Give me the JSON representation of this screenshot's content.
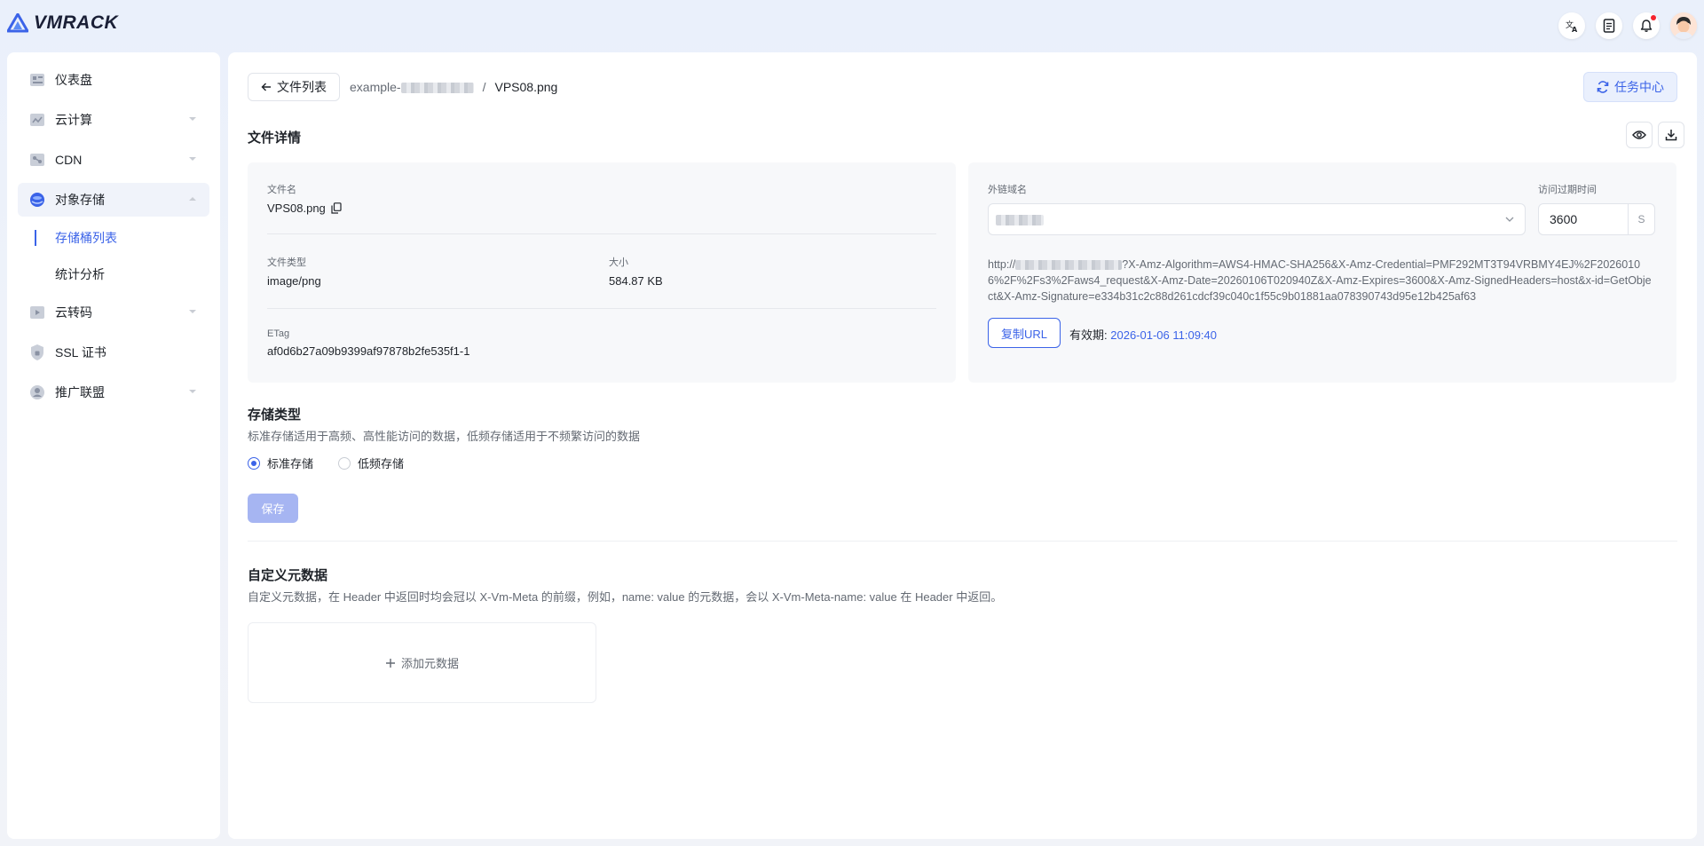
{
  "app": {
    "brand": "VMRACK"
  },
  "topbar": {
    "icons": [
      "translate-icon",
      "document-icon",
      "bell-icon",
      "avatar"
    ]
  },
  "sidebar": {
    "items": [
      {
        "label": "仪表盘",
        "icon": "dashboard-icon",
        "has_caret": false
      },
      {
        "label": "云计算",
        "icon": "cloud-compute-icon",
        "has_caret": true
      },
      {
        "label": "CDN",
        "icon": "cdn-icon",
        "has_caret": true
      },
      {
        "label": "对象存储",
        "icon": "object-storage-icon",
        "has_caret": true,
        "expanded": true
      },
      {
        "label": "云转码",
        "icon": "transcode-icon",
        "has_caret": true
      },
      {
        "label": "SSL 证书",
        "icon": "ssl-shield-icon",
        "has_caret": false
      },
      {
        "label": "推广联盟",
        "icon": "affiliate-icon",
        "has_caret": true
      }
    ],
    "subitems": [
      {
        "label": "存储桶列表",
        "active": true
      },
      {
        "label": "统计分析",
        "active": false
      }
    ]
  },
  "header": {
    "back_label": "文件列表",
    "breadcrumb_bucket": "example-",
    "breadcrumb_sep": "/",
    "breadcrumb_file": "VPS08.png",
    "task_center": "任务中心"
  },
  "file_details": {
    "title": "文件详情",
    "name_label": "文件名",
    "name_value": "VPS08.png",
    "type_label": "文件类型",
    "type_value": "image/png",
    "size_label": "大小",
    "size_value": "584.87 KB",
    "etag_label": "ETag",
    "etag_value": "af0d6b27a09b9399af97878b2fe535f1-1"
  },
  "link": {
    "domain_label": "外链域名",
    "expire_label": "访问过期时间",
    "expire_value": "3600",
    "expire_unit": "S",
    "url_prefix": "http://",
    "url_rest": "?X-Amz-Algorithm=AWS4-HMAC-SHA256&X-Amz-Credential=PMF292MT3T94VRBMY4EJ%2F20260106%2F%2Fs3%2Faws4_request&X-Amz-Date=20260106T020940Z&X-Amz-Expires=3600&X-Amz-SignedHeaders=host&x-id=GetObject&X-Amz-Signature=e334b31c2c88d261cdcf39c040c1f55c9b01881aa078390743d95e12b425af63",
    "copy_label": "复制URL",
    "valid_label": "有效期:",
    "valid_date": "2026-01-06 11:09:40"
  },
  "storage": {
    "title": "存储类型",
    "desc": "标准存储适用于高频、高性能访问的数据，低频存储适用于不频繁访问的数据",
    "options": [
      {
        "label": "标准存储",
        "checked": true
      },
      {
        "label": "低频存储",
        "checked": false
      }
    ],
    "save_label": "保存"
  },
  "metadata": {
    "title": "自定义元数据",
    "desc": "自定义元数据，在 Header 中返回时均会冠以 X-Vm-Meta 的前缀，例如，name: value 的元数据，会以 X-Vm-Meta-name: value 在 Header 中返回。",
    "add_label": "添加元数据"
  },
  "colors": {
    "accent": "#3b63e8",
    "save_disabled": "#a6b5f2"
  }
}
